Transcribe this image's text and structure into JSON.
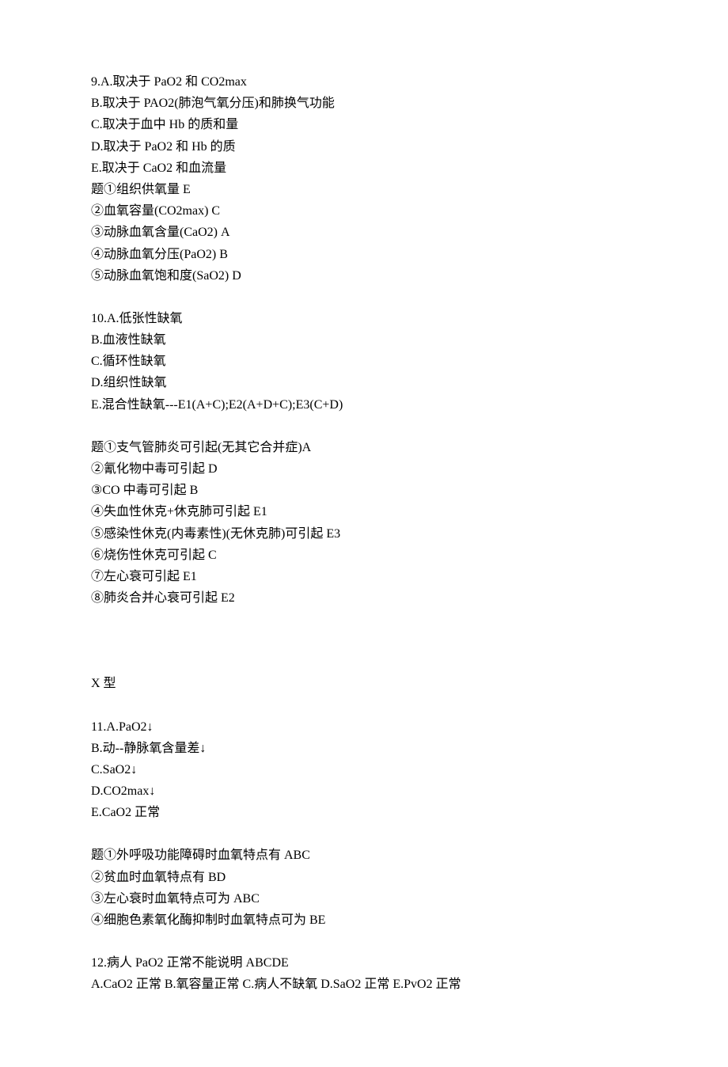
{
  "q9": {
    "header": "9.A.取决于 PaO2 和 CO2max",
    "opts": [
      "B.取决于 PAO2(肺泡气氧分压)和肺换气功能",
      "C.取决于血中 Hb 的质和量",
      "D.取决于 PaO2 和 Hb 的质",
      "E.取决于 CaO2 和血流量"
    ],
    "subs": [
      "题①组织供氧量 E",
      "②血氧容量(CO2max) C",
      "③动脉血氧含量(CaO2) A",
      "④动脉血氧分压(PaO2) B",
      "⑤动脉血氧饱和度(SaO2) D"
    ]
  },
  "q10": {
    "header": "10.A.低张性缺氧",
    "opts": [
      "B.血液性缺氧",
      "C.循环性缺氧",
      "D.组织性缺氧",
      "E.混合性缺氧---E1(A+C);E2(A+D+C);E3(C+D)"
    ],
    "subs": [
      "题①支气管肺炎可引起(无其它合并症)A",
      "②氰化物中毒可引起 D",
      "③CO 中毒可引起 B",
      "④失血性休克+休克肺可引起 E1",
      "⑤感染性休克(内毒素性)(无休克肺)可引起 E3",
      "⑥烧伤性休克可引起 C",
      "⑦左心衰可引起 E1",
      "⑧肺炎合并心衰可引起 E2"
    ]
  },
  "xtype": "X 型",
  "q11": {
    "header": "11.A.PaO2↓",
    "opts": [
      "B.动--静脉氧含量差↓",
      "C.SaO2↓",
      "D.CO2max↓",
      "E.CaO2 正常"
    ],
    "subs": [
      "题①外呼吸功能障碍时血氧特点有 ABC",
      "②贫血时血氧特点有 BD",
      "③左心衰时血氧特点可为 ABC",
      "④细胞色素氧化酶抑制时血氧特点可为 BE"
    ]
  },
  "q12": {
    "header": "12.病人 PaO2 正常不能说明 ABCDE",
    "opts": [
      "A.CaO2 正常 B.氧容量正常 C.病人不缺氧 D.SaO2 正常 E.PvO2 正常"
    ]
  }
}
